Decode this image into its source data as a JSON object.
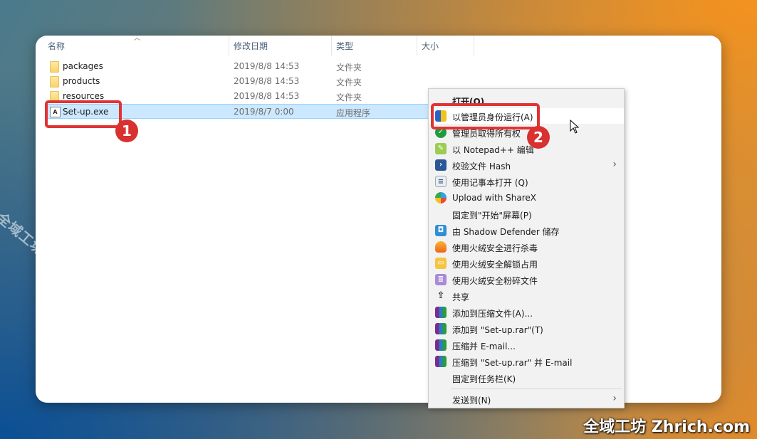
{
  "columns": [
    {
      "label": "名称"
    },
    {
      "label": "修改日期"
    },
    {
      "label": "类型"
    },
    {
      "label": "大小"
    }
  ],
  "files": [
    {
      "name": "packages",
      "date": "2019/8/8 14:53",
      "type": "文件夹",
      "icon": "folder-icon"
    },
    {
      "name": "products",
      "date": "2019/8/8 14:53",
      "type": "文件夹",
      "icon": "folder-icon"
    },
    {
      "name": "resources",
      "date": "2019/8/8 14:53",
      "type": "文件夹",
      "icon": "folder-icon"
    },
    {
      "name": "Set-up.exe",
      "date": "2019/8/7 0:00",
      "type": "应用程序",
      "icon": "application-icon",
      "selected": true
    }
  ],
  "annotations": {
    "badge1": "1",
    "badge2": "2"
  },
  "context_menu": {
    "items": [
      {
        "label": "打开(O)",
        "bold": true
      },
      {
        "label": "以管理员身份运行(A)",
        "icon": "uac-shield-icon",
        "hover": true
      },
      {
        "label": "管理员取得所有权",
        "icon": "green-shield-icon"
      },
      {
        "label": "以 Notepad++ 编辑",
        "icon": "notepad-plus-plus-icon"
      },
      {
        "label": "校验文件 Hash",
        "icon": "powershell-icon",
        "submenu": true
      },
      {
        "label": "使用记事本打开 (Q)",
        "icon": "notepad-icon"
      },
      {
        "label": "Upload with ShareX",
        "icon": "sharex-icon"
      },
      {
        "label": "固定到\"开始\"屏幕(P)"
      },
      {
        "label": "由 Shadow Defender 储存",
        "icon": "shadow-defender-icon"
      },
      {
        "label": "使用火绒安全进行杀毒",
        "icon": "huorong-flame-icon"
      },
      {
        "label": "使用火绒安全解锁占用",
        "icon": "huorong-unlock-icon"
      },
      {
        "label": "使用火绒安全粉碎文件",
        "icon": "huorong-shred-icon"
      },
      {
        "label": "共享",
        "icon": "share-icon"
      },
      {
        "label": "添加到压缩文件(A)...",
        "icon": "winrar-icon"
      },
      {
        "label": "添加到 \"Set-up.rar\"(T)",
        "icon": "winrar-icon"
      },
      {
        "label": "压缩并 E-mail...",
        "icon": "winrar-icon"
      },
      {
        "label": "压缩到 \"Set-up.rar\" 并 E-mail",
        "icon": "winrar-icon"
      },
      {
        "label": "固定到任务栏(K)"
      },
      {
        "label": "发送到(N)",
        "submenu": true,
        "separator_before": true
      }
    ]
  },
  "watermark": "全域工坊 zhrich.com",
  "brand": "全域工坊 Zhrich.com",
  "colors": {
    "selection_bg": "#cce8ff",
    "callout_red": "#e03434",
    "menu_bg": "#f2f2f2"
  }
}
